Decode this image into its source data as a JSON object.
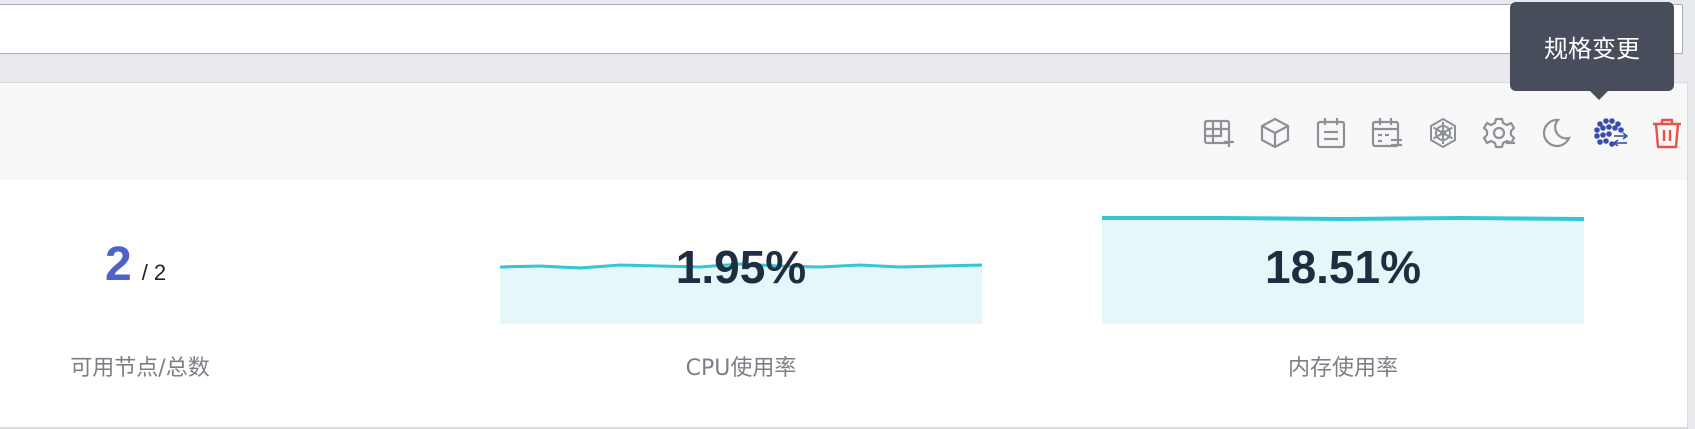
{
  "tooltip": {
    "text": "规格变更"
  },
  "toolbar": {
    "icons": [
      "grid-add-icon",
      "cube-icon",
      "calendar-icon",
      "calendar-manage-icon",
      "helm-wheel-icon",
      "settings-gear-icon",
      "moon-sleep-icon",
      "spec-change-icon",
      "trash-icon"
    ],
    "active_color": "#3a4dae",
    "delete_color": "#e5534b",
    "default_color": "#8d9099"
  },
  "stats": {
    "nodes": {
      "available": "2",
      "total": "/ 2",
      "label": "可用节点/总数"
    },
    "cpu": {
      "value": "1.95%",
      "label": "CPU使用率"
    },
    "memory": {
      "value": "18.51%",
      "label": "内存使用率"
    }
  },
  "colors": {
    "spark_line": "#35c6d6",
    "spark_fill": "#e6f7f9",
    "node_number": "#4e63c9"
  }
}
